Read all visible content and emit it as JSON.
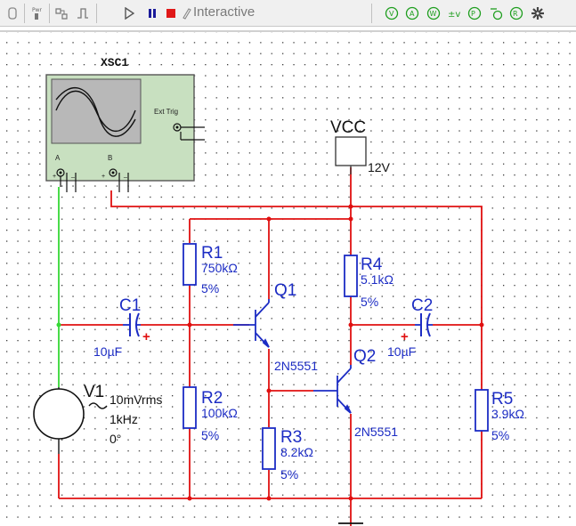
{
  "toolbar": {
    "mode_label": "Interactive",
    "icons": [
      "probe-icon",
      "power-icon",
      "component-icon",
      "wire-icon",
      "play-icon",
      "pause-icon",
      "stop-icon",
      "interactive-icon",
      "voltmeter-icon",
      "ammeter-icon",
      "wattmeter-icon",
      "voltage-diff-icon",
      "power-probe-icon",
      "current-probe-icon",
      "reference-probe-icon",
      "probe-settings-icon"
    ]
  },
  "schematic": {
    "oscilloscope": {
      "name": "XSC1",
      "ext_trig": "Ext Trig",
      "ch_a": "A",
      "ch_b": "B",
      "plus": "+",
      "minus": "_"
    },
    "vcc": {
      "label": "VCC",
      "value": "12V"
    },
    "r1": {
      "name": "R1",
      "value": "750kΩ",
      "tol": "5%"
    },
    "r2": {
      "name": "R2",
      "value": "100kΩ",
      "tol": "5%"
    },
    "r3": {
      "name": "R3",
      "value": "8.2kΩ",
      "tol": "5%"
    },
    "r4": {
      "name": "R4",
      "value": "5.1kΩ",
      "tol": "5%"
    },
    "r5": {
      "name": "R5",
      "value": "3.9kΩ",
      "tol": "5%"
    },
    "c1": {
      "name": "C1",
      "value": "10µF",
      "plus": "+"
    },
    "c2": {
      "name": "C2",
      "value": "10µF",
      "plus": "+"
    },
    "q1": {
      "name": "Q1",
      "model": "2N5551"
    },
    "q2": {
      "name": "Q2",
      "model": "2N5551"
    },
    "v1": {
      "name": "V1",
      "amplitude": "10mVrms",
      "freq": "1kHz",
      "phase": "0°"
    },
    "colors": {
      "wire": "#e01010",
      "green_wire": "#35d835",
      "component": "#1c2cc4",
      "scope_body": "#c8e0c0"
    }
  }
}
